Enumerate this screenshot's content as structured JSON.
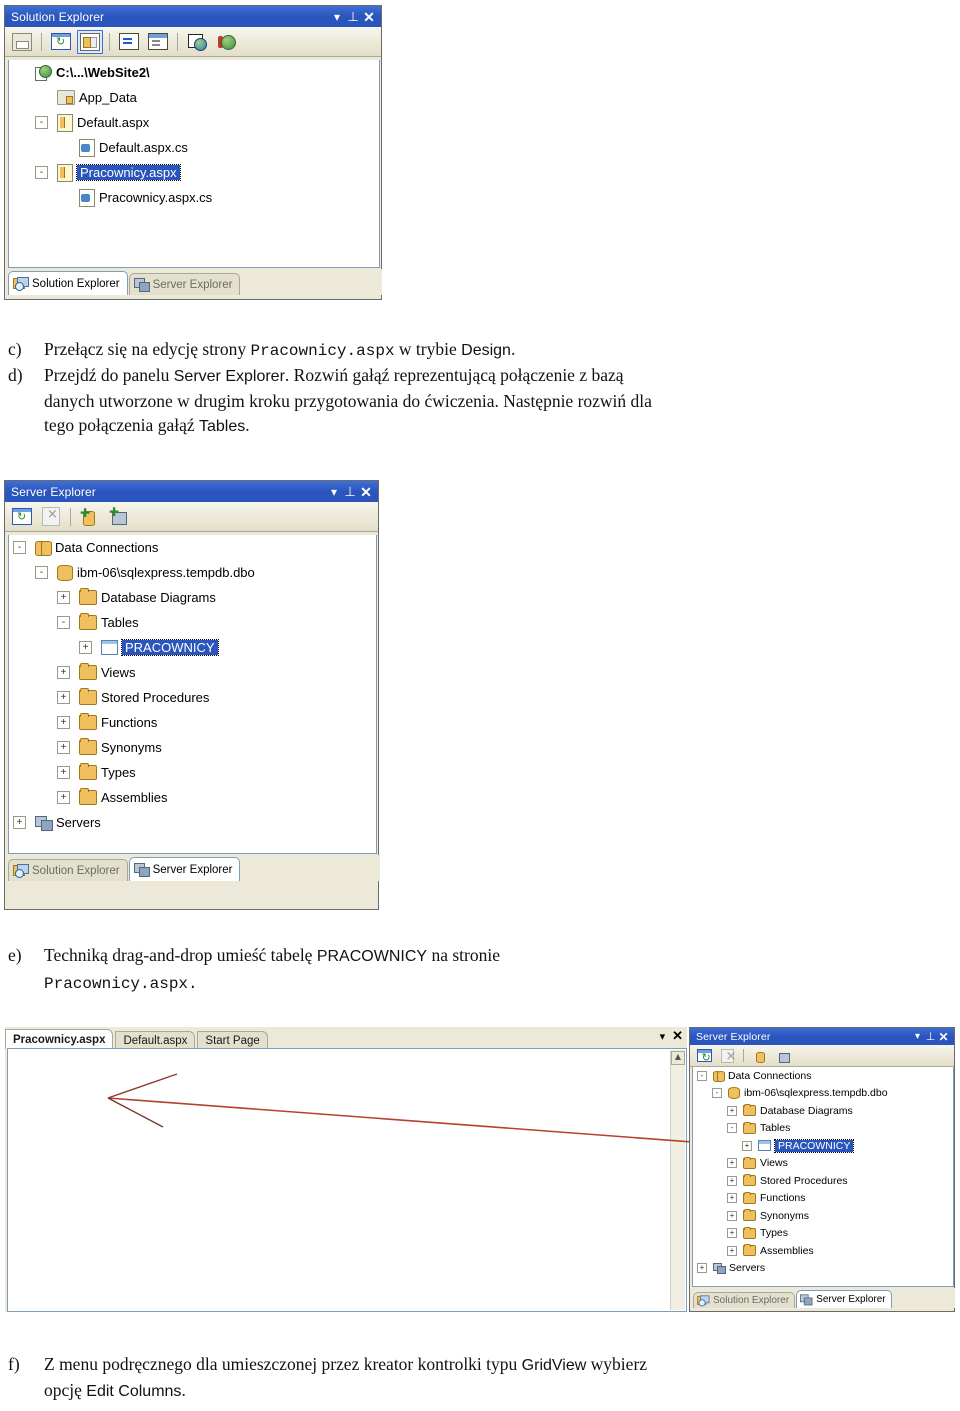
{
  "solution_explorer": {
    "title": "Solution Explorer",
    "title_controls": {
      "dropdown": "▾",
      "pin": "⊥",
      "close": "✕"
    },
    "toolbar": [
      {
        "name": "properties-button",
        "icon": "properties-icon"
      },
      {
        "name": "refresh-button",
        "icon": "refresh-icon"
      },
      {
        "name": "nest-related-files-button",
        "icon": "nest-related-files-icon"
      },
      {
        "name": "view-code-button",
        "icon": "view-code-icon"
      },
      {
        "name": "view-designer-button",
        "icon": "view-designer-icon"
      },
      {
        "name": "copy-website-button",
        "icon": "copy-website-icon"
      },
      {
        "name": "asp-configuration-button",
        "icon": "asp-configuration-icon"
      }
    ],
    "tree": [
      {
        "label": "C:\\...\\WebSite2\\",
        "icon": "website-icon",
        "indent": 0,
        "toggle": "",
        "bold": true,
        "selected": false
      },
      {
        "label": "App_Data",
        "icon": "folder-locked-icon",
        "indent": 1,
        "toggle": "",
        "bold": false,
        "selected": false
      },
      {
        "label": "Default.aspx",
        "icon": "aspx-page-icon",
        "indent": 1,
        "toggle": "-",
        "bold": false,
        "selected": false
      },
      {
        "label": "Default.aspx.cs",
        "icon": "csharp-file-icon",
        "indent": 2,
        "toggle": "",
        "bold": false,
        "selected": false
      },
      {
        "label": "Pracownicy.aspx",
        "icon": "aspx-page-icon",
        "indent": 1,
        "toggle": "-",
        "bold": false,
        "selected": true
      },
      {
        "label": "Pracownicy.aspx.cs",
        "icon": "csharp-file-icon",
        "indent": 2,
        "toggle": "",
        "bold": false,
        "selected": false
      }
    ],
    "tabs": [
      {
        "label": "Solution Explorer",
        "icon": "solution-explorer-icon",
        "active": true
      },
      {
        "label": "Server Explorer",
        "icon": "server-explorer-icon",
        "active": false
      }
    ]
  },
  "instruction_c": {
    "marker": "c)",
    "part1": "Przełącz się na edycję strony ",
    "mono1": "Pracownicy.aspx",
    "part2": " w trybie ",
    "sans1": "Design",
    "part3": "."
  },
  "instruction_d": {
    "marker": "d)",
    "line1a": "Przejdź do panelu ",
    "line1b": "Server Explorer",
    "line1c": ". Rozwiń gałąź reprezentującą połączenie z bazą",
    "line2": "danych utworzone w drugim kroku przygotowania do ćwiczenia. Następnie rozwiń dla",
    "line3a": "tego połączenia gałąź ",
    "line3b": "Tables",
    "line3c": "."
  },
  "server_explorer": {
    "title": "Server Explorer",
    "title_controls": {
      "dropdown": "▾",
      "pin": "⊥",
      "close": "✕"
    },
    "toolbar": [
      {
        "name": "refresh-button",
        "icon": "refresh-icon"
      },
      {
        "name": "delete-button",
        "icon": "delete-icon"
      },
      {
        "name": "connect-to-database-button",
        "icon": "connect-database-icon"
      },
      {
        "name": "add-server-button",
        "icon": "add-server-icon"
      }
    ],
    "tree": [
      {
        "label": "Data Connections",
        "icon": "data-connections-icon",
        "indent": 0,
        "toggle": "-",
        "selected": false
      },
      {
        "label": "ibm-06\\sqlexpress.tempdb.dbo",
        "icon": "database-connection-icon",
        "indent": 1,
        "toggle": "-",
        "selected": false
      },
      {
        "label": "Database Diagrams",
        "icon": "folder-icon",
        "indent": 2,
        "toggle": "+",
        "selected": false
      },
      {
        "label": "Tables",
        "icon": "folder-icon",
        "indent": 2,
        "toggle": "-",
        "selected": false
      },
      {
        "label": "PRACOWNICY",
        "icon": "table-icon",
        "indent": 3,
        "toggle": "+",
        "selected": true
      },
      {
        "label": "Views",
        "icon": "folder-icon",
        "indent": 2,
        "toggle": "+",
        "selected": false
      },
      {
        "label": "Stored Procedures",
        "icon": "folder-icon",
        "indent": 2,
        "toggle": "+",
        "selected": false
      },
      {
        "label": "Functions",
        "icon": "folder-icon",
        "indent": 2,
        "toggle": "+",
        "selected": false
      },
      {
        "label": "Synonyms",
        "icon": "folder-icon",
        "indent": 2,
        "toggle": "+",
        "selected": false
      },
      {
        "label": "Types",
        "icon": "folder-icon",
        "indent": 2,
        "toggle": "+",
        "selected": false
      },
      {
        "label": "Assemblies",
        "icon": "folder-icon",
        "indent": 2,
        "toggle": "+",
        "selected": false
      },
      {
        "label": "Servers",
        "icon": "servers-icon",
        "indent": 0,
        "toggle": "+",
        "selected": false
      }
    ],
    "tabs": [
      {
        "label": "Solution Explorer",
        "icon": "solution-explorer-icon",
        "active": false
      },
      {
        "label": "Server Explorer",
        "icon": "server-explorer-icon",
        "active": true
      }
    ]
  },
  "instruction_e": {
    "marker": "e)",
    "line1a": "Techniką drag-and-drop umieść tabelę ",
    "line1b": "PRACOWNICY",
    "line1c": " na stronie",
    "line2": "Pracownicy.aspx."
  },
  "bottom_shot": {
    "editor": {
      "tabs": [
        {
          "label": "Pracownicy.aspx",
          "active": true
        },
        {
          "label": "Default.aspx",
          "active": false
        },
        {
          "label": "Start Page",
          "active": false
        }
      ],
      "controls": {
        "dropdown": "▾",
        "close": "✕"
      },
      "scroll_up": "▲"
    },
    "annotation": {
      "arrow_color": "#b4422c",
      "name": "drag-drop-arrow"
    },
    "server_explorer": {
      "title": "Server Explorer",
      "title_controls": {
        "dropdown": "▾",
        "pin": "⊥",
        "close": "✕"
      },
      "toolbar": [
        {
          "name": "refresh-button",
          "icon": "refresh-icon"
        },
        {
          "name": "delete-button",
          "icon": "delete-icon"
        },
        {
          "name": "connect-to-database-button",
          "icon": "connect-database-icon"
        },
        {
          "name": "add-server-button",
          "icon": "add-server-icon"
        }
      ],
      "tree": [
        {
          "label": "Data Connections",
          "icon": "data-connections-icon",
          "indent": 0,
          "toggle": "-",
          "selected": false
        },
        {
          "label": "ibm-06\\sqlexpress.tempdb.dbo",
          "icon": "database-connection-icon",
          "indent": 1,
          "toggle": "-",
          "selected": false
        },
        {
          "label": "Database Diagrams",
          "icon": "folder-icon",
          "indent": 2,
          "toggle": "+",
          "selected": false
        },
        {
          "label": "Tables",
          "icon": "folder-icon",
          "indent": 2,
          "toggle": "-",
          "selected": false
        },
        {
          "label": "PRACOWNICY",
          "icon": "table-icon",
          "indent": 3,
          "toggle": "+",
          "selected": true
        },
        {
          "label": "Views",
          "icon": "folder-icon",
          "indent": 2,
          "toggle": "+",
          "selected": false
        },
        {
          "label": "Stored Procedures",
          "icon": "folder-icon",
          "indent": 2,
          "toggle": "+",
          "selected": false
        },
        {
          "label": "Functions",
          "icon": "folder-icon",
          "indent": 2,
          "toggle": "+",
          "selected": false
        },
        {
          "label": "Synonyms",
          "icon": "folder-icon",
          "indent": 2,
          "toggle": "+",
          "selected": false
        },
        {
          "label": "Types",
          "icon": "folder-icon",
          "indent": 2,
          "toggle": "+",
          "selected": false
        },
        {
          "label": "Assemblies",
          "icon": "folder-icon",
          "indent": 2,
          "toggle": "+",
          "selected": false
        },
        {
          "label": "Servers",
          "icon": "servers-icon",
          "indent": 0,
          "toggle": "+",
          "selected": false
        }
      ],
      "tabs": [
        {
          "label": "Solution Explorer",
          "icon": "solution-explorer-icon",
          "active": false
        },
        {
          "label": "Server Explorer",
          "icon": "server-explorer-icon",
          "active": true
        }
      ]
    }
  },
  "instruction_f": {
    "marker": "f)",
    "line1a": "Z menu podręcznego dla umieszczonej przez kreator kontrolki typu ",
    "line1b": "GridView",
    "line1c": " wybierz",
    "line2a": "opcję ",
    "line2b": "Edit Columns",
    "line2c": "."
  },
  "colors": {
    "title_bar": "#2a55bd",
    "selection": "#2a55bd",
    "panel_bg": "#ece9d8",
    "tree_bg": "#ffffff",
    "arrow": "#b4422c"
  }
}
